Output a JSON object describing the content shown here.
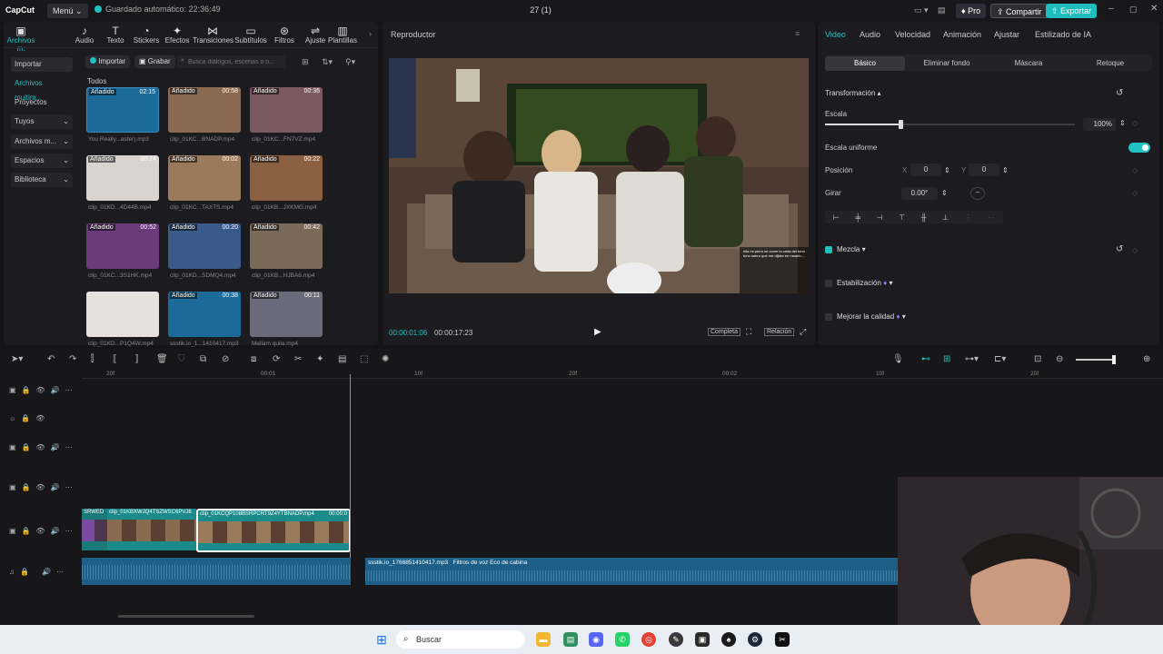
{
  "app": {
    "logo": "CapCut",
    "menu": "Menú",
    "autosave": "Guardado automático: 22:36:49",
    "project_title": "27 (1)",
    "pro": "Pro",
    "share": "Compartir",
    "export": "Exportar"
  },
  "toolbar_tabs": [
    "Archivos m.",
    "Audio",
    "Texto",
    "Stickers",
    "Efectos",
    "Transiciones",
    "Subtítulos",
    "Filtros",
    "Ajuste",
    "Plantillas"
  ],
  "media": {
    "import_btn": "Importar",
    "record_btn": "Grabar",
    "search_placeholder": "Busca diálogos, escenas o n...",
    "section": "Todos",
    "added_label": "Añadido",
    "items": [
      {
        "dur": "02:15",
        "name": "You Really...aster).mp3"
      },
      {
        "dur": "00:58",
        "name": "clip_01KC...BNADP.mp4"
      },
      {
        "dur": "00:36",
        "name": "clip_01KC...FN7VZ.mp4"
      },
      {
        "dur": "00:24",
        "name": "clip_01KD...4D44B.mp4"
      },
      {
        "dur": "00:02",
        "name": "clip_01KC...TAXTS.mp4"
      },
      {
        "dur": "00:22",
        "name": "clip_01KB...JXKMG.mp4"
      },
      {
        "dur": "00:52",
        "name": "clip_01KC...3S1HK.mp4"
      },
      {
        "dur": "00:20",
        "name": "clip_01KD...SDMQ4.mp4"
      },
      {
        "dur": "00:42",
        "name": "clip_01KB...HJBA6.mp4"
      },
      {
        "dur": "",
        "name": "clip_01KD...P1Q4W.mp4"
      },
      {
        "dur": "00:38",
        "name": "ssstik.io_1...1410417.mp3"
      },
      {
        "dur": "00:11",
        "name": "Mellam quila.mp4"
      }
    ]
  },
  "sidebar": [
    "Importar",
    "Archivos multim...",
    "Proyectos secun...",
    "Tuyos",
    "Archivos m...",
    "Espacios",
    "Biblioteca"
  ],
  "player": {
    "title": "Reproductor",
    "current": "00:00:01:06",
    "total": "00:00:17:23",
    "full": "Completa",
    "ratio": "Relación"
  },
  "right_panel": {
    "tabs": [
      "Video",
      "Audio",
      "Velocidad",
      "Animación",
      "Ajustar",
      "Estilizado de IA"
    ],
    "subtabs": [
      "Básico",
      "Eliminar fondo",
      "Máscara",
      "Retoque"
    ],
    "transform": "Transformación",
    "scale": "Escala",
    "scale_value": "100%",
    "scale_fraction": 0.15,
    "uniform": "Escala uniforme",
    "position": "Posición",
    "pos_x_label": "X",
    "pos_x": "0",
    "pos_y_label": "Y",
    "pos_y": "0",
    "rotate": "Girar",
    "rotate_value": "0.00°",
    "blend": "Mezcla",
    "stabilize": "Estabilización",
    "enhance": "Mejorar la calidad"
  },
  "timeline": {
    "ruler": [
      "20f",
      "00:01",
      "10f",
      "20f",
      "00:02",
      "10f",
      "20f"
    ],
    "clip1": "SRWED",
    "clip2": "clip_01KBXWJQ4TSZWSC6PVJ6",
    "clip3": "clip_01KCQP108BSRPCRT9Z4YTBNADP.mp4",
    "clip3_dur": "00:00:0",
    "audio_name": "ssstik.io_1766851410417.mp3",
    "audio_fx": "Filtros de voz Eco de cabina"
  },
  "video_caption": "ella mi perro se come la carta del tuno tuno sahur que me dijiste en rosario...",
  "taskbar": {
    "search": "Buscar"
  },
  "colors": {
    "accent": "#22c2c2",
    "export": "#1fbdbd",
    "clip": "#1a8a8a",
    "audio": "#1d5f86"
  }
}
